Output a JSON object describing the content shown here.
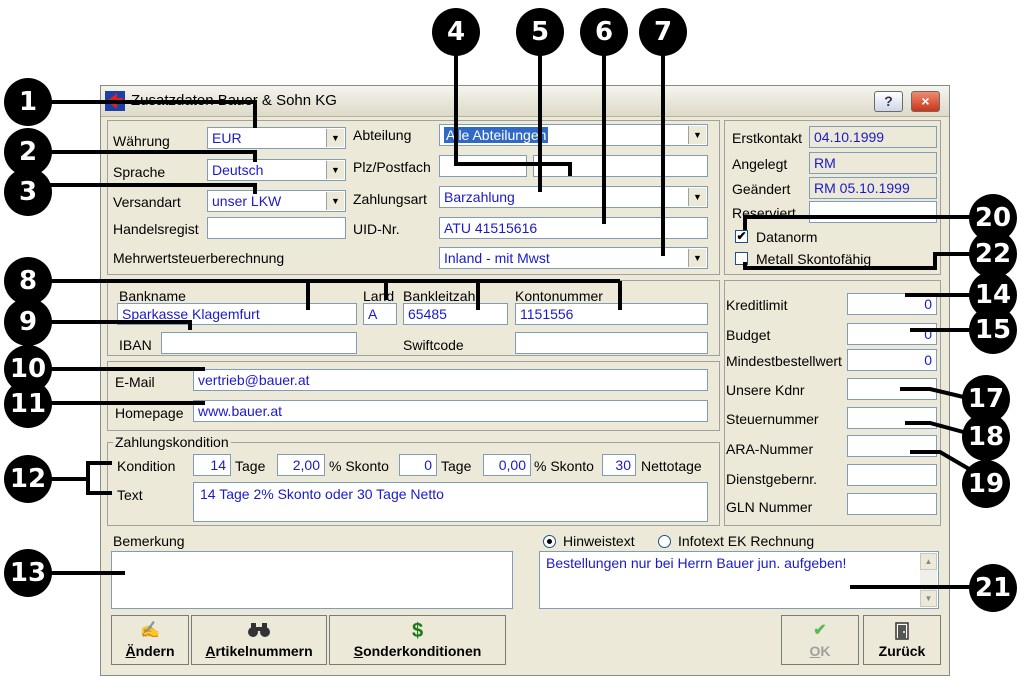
{
  "window": {
    "title": "Zusatzdaten Bauer & Sohn KG",
    "help_label": "?",
    "close_label": "×"
  },
  "general": {
    "waehrung_label": "Währung",
    "waehrung_value": "EUR",
    "sprache_label": "Sprache",
    "sprache_value": "Deutsch",
    "versandart_label": "Versandart",
    "versandart_value": "unser LKW",
    "handelsregist_label": "Handelsregist",
    "handelsregist_value": "",
    "mwst_label": "Mehrwertsteuerberechnung",
    "abteilung_label": "Abteilung",
    "abteilung_value": "Alle Abteilungen",
    "plz_label": "Plz/Postfach",
    "plz_value": "",
    "postfach_value": "",
    "zahlungsart_label": "Zahlungsart",
    "zahlungsart_value": "Barzahlung",
    "uid_label": "UID-Nr.",
    "uid_value": "ATU 41515616",
    "mwst_value": "Inland - mit Mwst"
  },
  "info": {
    "erstkontakt_label": "Erstkontakt",
    "erstkontakt_value": "04.10.1999",
    "angelegt_label": "Angelegt",
    "angelegt_value": "RM",
    "geaendert_label": "Geändert",
    "geaendert_value": "RM 05.10.1999",
    "reserviert_label": "Reserviert",
    "reserviert_value": "",
    "datanorm_label": "Datanorm",
    "datanorm_check": "✔",
    "skonto_label": "Metall Skontofähig"
  },
  "bank": {
    "bankname_label": "Bankname",
    "bankname_value": "Sparkasse Klagemfurt",
    "land_label": "Land",
    "land_value": "A",
    "blz_label": "Bankleitzahl",
    "blz_value": "65485",
    "konto_label": "Kontonummer",
    "konto_value": "1151556",
    "iban_label": "IBAN",
    "iban_value": "",
    "swift_label": "Swiftcode",
    "swift_value": ""
  },
  "contact": {
    "email_label": "E-Mail",
    "email_value": "vertrieb@bauer.at",
    "homepage_label": "Homepage",
    "homepage_value": "www.bauer.at"
  },
  "payment": {
    "group_label": "Zahlungskondition",
    "kondition_label": "Kondition",
    "tage1_value": "14",
    "tage_label": "Tage",
    "skonto1_value": "2,00",
    "skonto_label": "% Skonto",
    "tage2_value": "0",
    "skonto2_value": "0,00",
    "netto_value": "30",
    "netto_label": "Nettotage",
    "text_label": "Text",
    "text_value": "14 Tage 2% Skonto oder 30 Tage Netto"
  },
  "limits": {
    "kreditlimit_label": "Kreditlimit",
    "kreditlimit_value": "0",
    "budget_label": "Budget",
    "budget_value": "0",
    "mindest_label": "Mindestbestellwert",
    "mindest_value": "0",
    "kdnr_label": "Unsere Kdnr",
    "steuer_label": "Steuernummer",
    "ara_label": "ARA-Nummer",
    "dienst_label": "Dienstgebernr.",
    "gln_label": "GLN Nummer"
  },
  "remarks": {
    "bemerkung_label": "Bemerkung",
    "bemerkung_value": "",
    "hinweis_label": "Hinweistext",
    "infotext_label": "Infotext EK Rechnung",
    "hinweis_value": "Bestellungen nur bei Herrn Bauer jun. aufgeben!"
  },
  "buttons": {
    "aendern_u": "Ä",
    "aendern_rest": "ndern",
    "artikel_u": "A",
    "artikel_rest": "rtikelnummern",
    "sonder_u": "S",
    "sonder_rest": "onderkonditionen",
    "ok_u": "O",
    "ok_rest": "K",
    "zurueck_label": "Zurück"
  },
  "icons": {
    "aendern": "hand-pen-icon",
    "artikel": "binoculars-icon",
    "sonder": "dollar-icon",
    "ok": "checkmark-icon",
    "zurueck": "door-icon",
    "dollar_glyph": "$",
    "check_glyph": "✔",
    "binoc_glyph": "🔭",
    "hand_glyph": "✍"
  },
  "callouts": [
    "1",
    "2",
    "3",
    "4",
    "5",
    "6",
    "7",
    "8",
    "9",
    "10",
    "11",
    "12",
    "13",
    "14",
    "15",
    "17",
    "18",
    "19",
    "20",
    "21",
    "22"
  ],
  "colors": {
    "value_text": "#1a1acc",
    "selection": "#316ac5",
    "window_bg": "#ece9d8"
  }
}
